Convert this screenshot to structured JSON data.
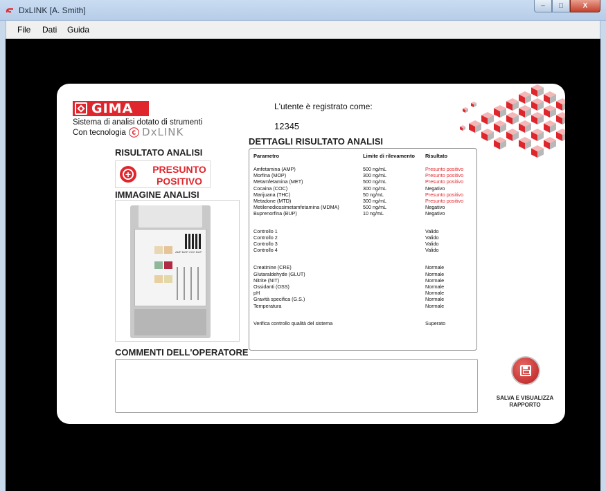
{
  "window": {
    "title": "DxLINK [A. Smith]",
    "buttons": {
      "minimize": "–",
      "maximize": "□",
      "close": "X"
    }
  },
  "menu": {
    "items": [
      "File",
      "Dati",
      "Guida"
    ]
  },
  "brand": {
    "logo_text": "GIMA",
    "tagline_line1": "Sistema di analisi dotato di strumenti",
    "tagline_line2": "Con tecnologia",
    "dx_logo": "DxLINK",
    "accent_color": "#e0262d"
  },
  "user": {
    "label": "L'utente è registrato come:",
    "id": "12345"
  },
  "result": {
    "heading": "RISULTATO ANALISI",
    "line1": "PRESUNTO",
    "line2": "POSITIVO"
  },
  "image": {
    "heading": "IMMAGINE ANALISI"
  },
  "comments": {
    "heading": "COMMENTI DELL'OPERATORE",
    "value": ""
  },
  "details": {
    "heading": "DETTAGLI RISULTATO ANALISI",
    "columns": [
      "Parametro",
      "Limite di rilevamento",
      "Risultato"
    ],
    "drugs": [
      {
        "param": "Amfetamina (AMP)",
        "limit": "500 ng/mL",
        "result": "Presunto positivo",
        "positive": true
      },
      {
        "param": "Morfina (MOP)",
        "limit": "300 ng/mL",
        "result": "Presunto positivo",
        "positive": true
      },
      {
        "param": "Metamfetamina (MET)",
        "limit": "500 ng/mL",
        "result": "Presunto positivo",
        "positive": true
      },
      {
        "param": "Cocaina (COC)",
        "limit": "300 ng/mL",
        "result": "Negativo",
        "positive": false
      },
      {
        "param": "Marijuana (THC)",
        "limit": "50 ng/mL",
        "result": "Presunto positivo",
        "positive": true
      },
      {
        "param": "Metadone (MTD)",
        "limit": "300 ng/mL",
        "result": "Presunto positivo",
        "positive": true
      },
      {
        "param": "Metilenediossimetamfetamina (MDMA)",
        "limit": "500 ng/mL",
        "result": "Negativo",
        "positive": false
      },
      {
        "param": "Buprenorfina (BUP)",
        "limit": "10 ng/mL",
        "result": "Negativo",
        "positive": false
      }
    ],
    "controls": [
      {
        "param": "Controllo 1",
        "result": "Valido"
      },
      {
        "param": "Controllo 2",
        "result": "Valido"
      },
      {
        "param": "Controllo 3",
        "result": "Valido"
      },
      {
        "param": "Controllo 4",
        "result": "Valido"
      }
    ],
    "adulterants": [
      {
        "param": "Creatinine (CRE)",
        "result": "Normale"
      },
      {
        "param": "Glutaraldehyde (GLUT)",
        "result": "Normale"
      },
      {
        "param": "Nitrite (NIT)",
        "result": "Normale"
      },
      {
        "param": "Ossidanti (OSS)",
        "result": "Normale"
      },
      {
        "param": "pH",
        "result": "Normale"
      },
      {
        "param": "Gravità specifica (G.S.)",
        "result": "Normale"
      },
      {
        "param": "Temperatura",
        "result": "Normale"
      }
    ],
    "qc": {
      "param": "Verifica controllo qualità del sistema",
      "result": "Superato"
    }
  },
  "save": {
    "line1": "SALVA E VISUALIZZA",
    "line2": "RAPPORTO"
  }
}
